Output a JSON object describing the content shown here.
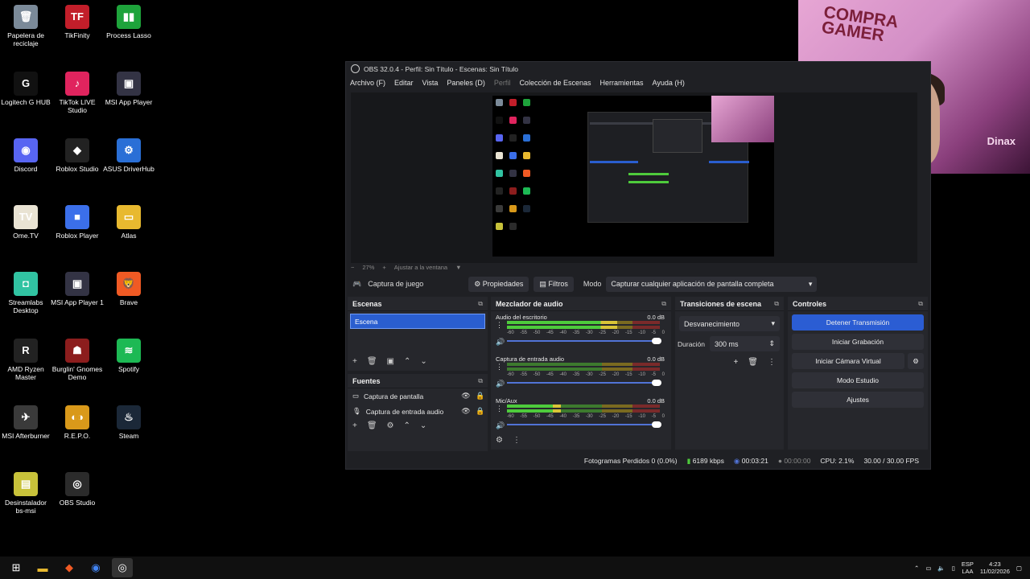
{
  "desktop": {
    "icons": [
      {
        "label": "Papelera de reciclaje",
        "icon": "recycle-bin-icon",
        "color": "#7b8a99",
        "glyph": "🗑"
      },
      {
        "label": "TikFinity",
        "icon": "tikfinity-icon",
        "color": "#c21e2a",
        "glyph": "TF"
      },
      {
        "label": "Process Lasso",
        "icon": "process-lasso-icon",
        "color": "#1ea33b",
        "glyph": "▮▮"
      },
      {
        "label": "Logitech G HUB",
        "icon": "logitech-icon",
        "color": "#111111",
        "glyph": "G"
      },
      {
        "label": "TikTok LIVE Studio",
        "icon": "tiktok-live-icon",
        "color": "#e0245e",
        "glyph": "♪"
      },
      {
        "label": "MSI App Player",
        "icon": "msi-app-player-icon",
        "color": "#333344",
        "glyph": "▣"
      },
      {
        "label": "Discord",
        "icon": "discord-icon",
        "color": "#5865f2",
        "glyph": "◉"
      },
      {
        "label": "Roblox Studio",
        "icon": "roblox-studio-icon",
        "color": "#222222",
        "glyph": "◆"
      },
      {
        "label": "ASUS DriverHub",
        "icon": "asus-driverhub-icon",
        "color": "#2a6fd6",
        "glyph": "⚙"
      },
      {
        "label": "Ome.TV",
        "icon": "ometv-icon",
        "color": "#e9e3d3",
        "glyph": "TV"
      },
      {
        "label": "Roblox Player",
        "icon": "roblox-player-icon",
        "color": "#3b6fea",
        "glyph": "■"
      },
      {
        "label": "Atlas",
        "icon": "folder-icon",
        "color": "#e8b92f",
        "glyph": "▭"
      },
      {
        "label": "Streamlabs Desktop",
        "icon": "streamlabs-icon",
        "color": "#31c3a2",
        "glyph": "◘"
      },
      {
        "label": "MSI App Player 1",
        "icon": "msi-app-player-icon",
        "color": "#333344",
        "glyph": "▣"
      },
      {
        "label": "Brave",
        "icon": "brave-icon",
        "color": "#f05a24",
        "glyph": "🦁"
      },
      {
        "label": "AMD Ryzen Master",
        "icon": "ryzen-master-icon",
        "color": "#222222",
        "glyph": "R"
      },
      {
        "label": "Burglin' Gnomes Demo",
        "icon": "burglin-gnomes-icon",
        "color": "#8c1d1d",
        "glyph": "☗"
      },
      {
        "label": "Spotify",
        "icon": "spotify-icon",
        "color": "#1db954",
        "glyph": "≋"
      },
      {
        "label": "MSI Afterburner",
        "icon": "msi-afterburner-icon",
        "color": "#3a3a3a",
        "glyph": "✈"
      },
      {
        "label": "R.E.P.O.",
        "icon": "repo-icon",
        "color": "#d9991a",
        "glyph": "◐◑"
      },
      {
        "label": "Steam",
        "icon": "steam-icon",
        "color": "#1b2838",
        "glyph": "♨"
      },
      {
        "label": "Desinstalador bs-msi",
        "icon": "uninstaller-icon",
        "color": "#c8c23a",
        "glyph": "▤"
      },
      {
        "label": "OBS Studio",
        "icon": "obs-studio-icon",
        "color": "#2b2b2b",
        "glyph": "◎"
      }
    ]
  },
  "webcam": {
    "watermark_line1": "COMPRA",
    "watermark_line2": "GAMER",
    "tag": "Dinax"
  },
  "obs": {
    "title": "OBS 32.0.4 - Perfil: Sin Título - Escenas: Sin Título",
    "menu": [
      "Archivo (F)",
      "Editar",
      "Vista",
      "Paneles (D)",
      "Perfil",
      "Colección de Escenas",
      "Herramientas",
      "Ayuda (H)"
    ],
    "zoom": "27%",
    "fit_label": "Ajustar a la ventana",
    "source_toolbar": {
      "source_name": "Captura de juego",
      "properties": "Propiedades",
      "filters": "Filtros",
      "mode_label": "Modo",
      "mode_value": "Capturar cualquier aplicación de pantalla completa"
    },
    "scenes": {
      "title": "Escenas",
      "items": [
        "Escena"
      ]
    },
    "sources": {
      "title": "Fuentes",
      "items": [
        "Captura de pantalla",
        "Captura de entrada audio"
      ]
    },
    "mixer": {
      "title": "Mezclador de audio",
      "channels": [
        {
          "name": "Audio del escritorio",
          "db": "0.0 dB",
          "level": 0.72
        },
        {
          "name": "Captura de entrada audio",
          "db": "0.0 dB",
          "level": 0.0
        },
        {
          "name": "Mic/Aux",
          "db": "0.0 dB",
          "level": 0.35
        }
      ],
      "ticks": [
        "-60",
        "-55",
        "-50",
        "-45",
        "-40",
        "-35",
        "-30",
        "-25",
        "-20",
        "-15",
        "-10",
        "-5",
        "0"
      ]
    },
    "transitions": {
      "title": "Transiciones de escena",
      "selected": "Desvanecimiento",
      "duration_label": "Duración",
      "duration_value": "300 ms"
    },
    "controls": {
      "title": "Controles",
      "stop_stream": "Detener Transmisión",
      "start_record": "Iniciar Grabación",
      "virtual_cam": "Iniciar Cámara Virtual",
      "studio_mode": "Modo Estudio",
      "settings": "Ajustes"
    },
    "status": {
      "dropped": "Fotogramas Perdidos 0 (0.0%)",
      "bitrate": "6189 kbps",
      "stream_time": "00:03:21",
      "rec_time": "00:00:00",
      "cpu": "CPU: 2.1%",
      "fps": "30.00 / 30.00 FPS"
    }
  },
  "taskbar": {
    "lang1": "ESP",
    "lang2": "LAA",
    "time": "4:23",
    "date": "11/02/2026"
  }
}
